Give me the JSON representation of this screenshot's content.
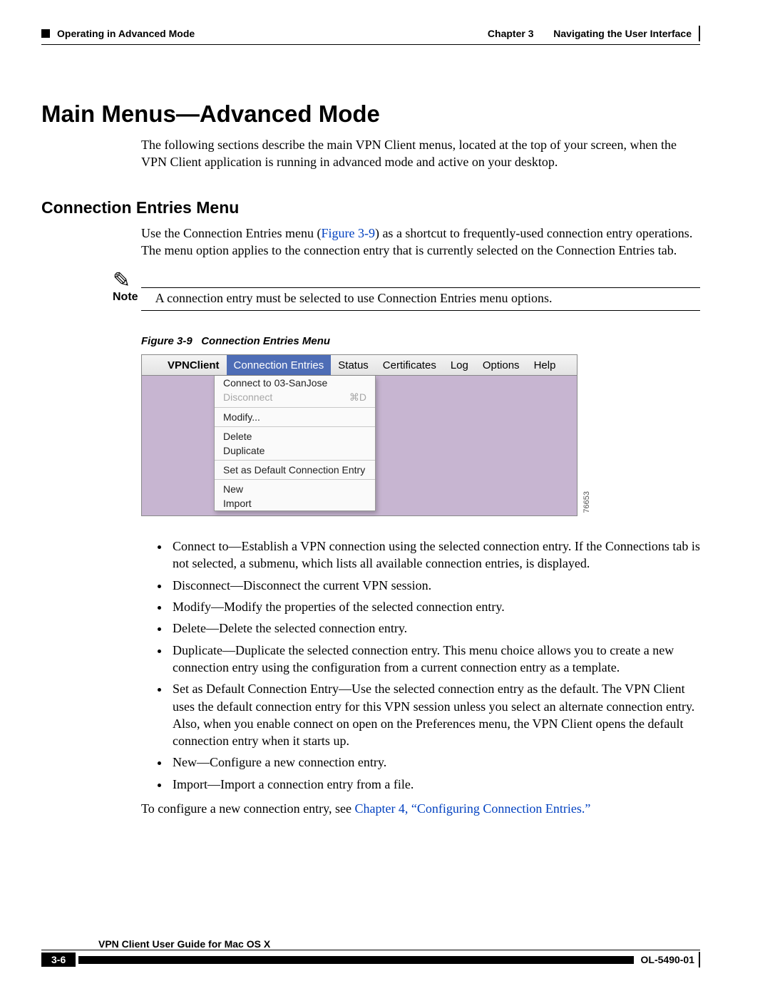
{
  "header": {
    "left_label": "Operating in Advanced Mode",
    "chapter_label": "Chapter 3",
    "chapter_title": "Navigating the User Interface"
  },
  "title": "Main Menus—Advanced Mode",
  "intro": "The following sections describe the main VPN Client menus, located at the top of your screen, when the VPN Client application is running in advanced mode and active on your desktop.",
  "subtitle": "Connection Entries Menu",
  "conn_body_a": "Use the Connection Entries menu (",
  "conn_ref": "Figure 3-9",
  "conn_body_b": ") as a shortcut to frequently-used connection entry operations. The menu option applies to the connection entry that is currently selected on the Connection Entries tab.",
  "note": {
    "label": "Note",
    "text": "A connection entry must be selected to use Connection Entries menu options."
  },
  "figure": {
    "caption_num": "Figure 3-9",
    "caption_text": "Connection Entries Menu",
    "id": "76653",
    "menubar": {
      "app": "VPNClient",
      "items": [
        "Connection Entries",
        "Status",
        "Certificates",
        "Log",
        "Options",
        "Help"
      ]
    },
    "dropdown": {
      "connect": "Connect to 03-SanJose",
      "disconnect": "Disconnect",
      "disconnect_shortcut": "⌘D",
      "modify": "Modify...",
      "delete": "Delete",
      "duplicate": "Duplicate",
      "set_default": "Set as Default Connection Entry",
      "new": "New",
      "import": "Import"
    }
  },
  "list": {
    "i0": "Connect to—Establish a VPN connection using the selected connection entry. If the Connections tab is not selected, a submenu, which lists all available connection entries, is displayed.",
    "i1": "Disconnect—Disconnect the current VPN session.",
    "i2": "Modify—Modify the properties of the selected connection entry.",
    "i3": "Delete—Delete the selected connection entry.",
    "i4": "Duplicate—Duplicate the selected connection entry. This menu choice allows you to create a new connection entry using the configuration from a current connection entry as a template.",
    "i5": "Set as Default Connection Entry—Use the selected connection entry as the default. The VPN Client uses the default connection entry for this VPN session unless you select an alternate connection entry. Also, when you enable connect on open on the Preferences menu, the VPN Client opens the default connection entry when it starts up.",
    "i6": "New—Configure a new connection entry.",
    "i7": "Import—Import a connection entry from a file."
  },
  "closing_a": "To configure a new connection entry, see ",
  "closing_link": "Chapter 4, “Configuring Connection Entries.”",
  "footer": {
    "guide": "VPN Client User Guide for Mac OS X",
    "page": "3-6",
    "docid": "OL-5490-01"
  }
}
